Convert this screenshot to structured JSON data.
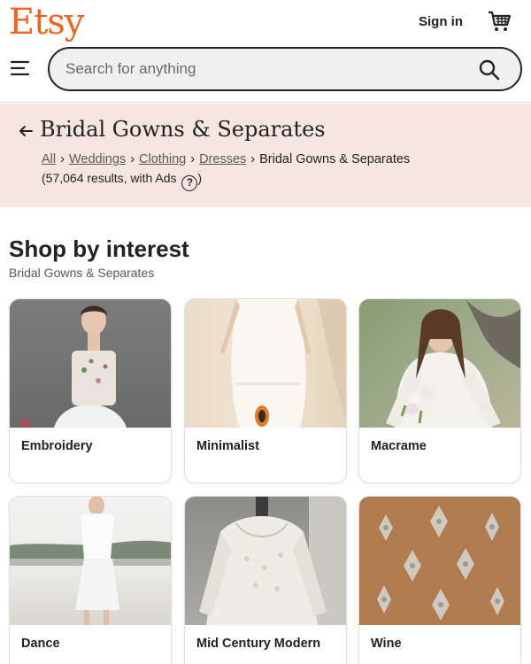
{
  "header": {
    "logo": "Etsy",
    "sign_in": "Sign in",
    "search_placeholder": "Search for anything",
    "accent_color": "#f1641e"
  },
  "category": {
    "title": "Bridal Gowns & Separates",
    "breadcrumbs": [
      "All",
      "Weddings",
      "Clothing",
      "Dresses"
    ],
    "current": "Bridal Gowns & Separates",
    "results": "(57,064 results, with Ads",
    "results_close": ")",
    "help_glyph": "?"
  },
  "interest": {
    "title": "Shop by interest",
    "subtitle": "Bridal Gowns & Separates",
    "cards": [
      {
        "label": "Embroidery",
        "image": "bride-embroidered-top-photo"
      },
      {
        "label": "Minimalist",
        "image": "bride-minimalist-dress-photo"
      },
      {
        "label": "Macrame",
        "image": "bride-lace-sleeves-photo"
      },
      {
        "label": "Dance",
        "image": "bride-short-dress-photo"
      },
      {
        "label": "Mid Century Modern",
        "image": "lace-dress-on-mannequin-photo"
      },
      {
        "label": "Wine",
        "image": "beaded-lace-fabric-photo"
      }
    ]
  }
}
